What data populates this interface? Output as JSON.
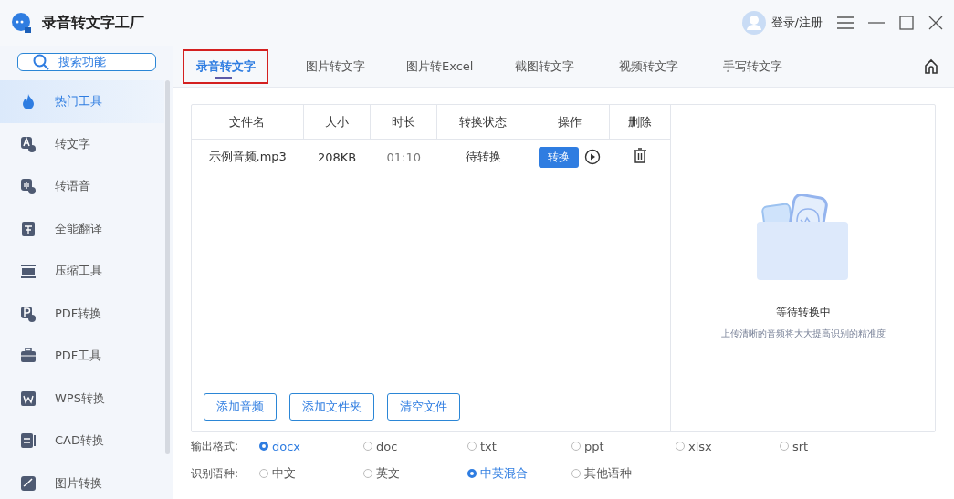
{
  "window": {
    "title": "录音转文字工厂",
    "login": "登录/注册"
  },
  "search": {
    "placeholder": "搜索功能"
  },
  "sidebar": {
    "items": [
      {
        "label": "热门工具",
        "selected": true
      },
      {
        "label": "转文字",
        "selected": false
      },
      {
        "label": "转语音",
        "selected": false
      },
      {
        "label": "全能翻译",
        "selected": false
      },
      {
        "label": "压缩工具",
        "selected": false
      },
      {
        "label": "PDF转换",
        "selected": false
      },
      {
        "label": "PDF工具",
        "selected": false
      },
      {
        "label": "WPS转换",
        "selected": false
      },
      {
        "label": "CAD转换",
        "selected": false
      },
      {
        "label": "图片转换",
        "selected": false
      }
    ]
  },
  "tabs": [
    {
      "label": "录音转文字",
      "selected": true
    },
    {
      "label": "图片转文字",
      "selected": false
    },
    {
      "label": "图片转Excel",
      "selected": false
    },
    {
      "label": "截图转文字",
      "selected": false
    },
    {
      "label": "视频转文字",
      "selected": false
    },
    {
      "label": "手写转文字",
      "selected": false
    }
  ],
  "table": {
    "columns": [
      "文件名",
      "大小",
      "时长",
      "转换状态",
      "操作",
      "删除"
    ],
    "rows": [
      {
        "name": "示例音频.mp3",
        "size": "208KB",
        "duration": "01:10",
        "status": "待转换",
        "action": "转换"
      }
    ]
  },
  "buttons": [
    "添加音频",
    "添加文件夹",
    "清空文件"
  ],
  "empty_state": {
    "title": "等待转换中",
    "hint": "上传清晰的音频将大大提高识别的精准度"
  },
  "options": [
    {
      "label": "输出格式:",
      "choices": [
        {
          "label": "docx",
          "selected": true
        },
        {
          "label": "doc",
          "selected": false
        },
        {
          "label": "txt",
          "selected": false
        },
        {
          "label": "ppt",
          "selected": false
        },
        {
          "label": "xlsx",
          "selected": false
        },
        {
          "label": "srt",
          "selected": false
        }
      ]
    },
    {
      "label": "识别语种:",
      "choices": [
        {
          "label": "中文",
          "selected": false
        },
        {
          "label": "英文",
          "selected": false
        },
        {
          "label": "中英混合",
          "selected": true
        },
        {
          "label": "其他语种",
          "selected": false
        }
      ]
    }
  ]
}
